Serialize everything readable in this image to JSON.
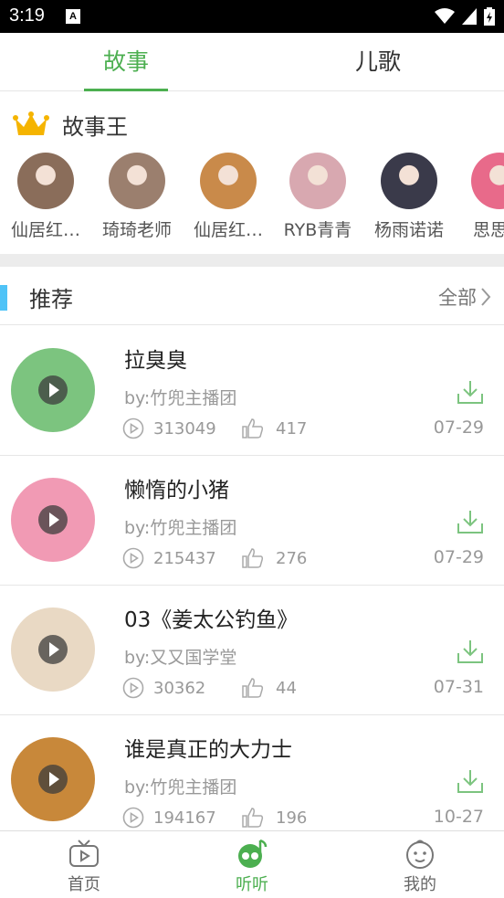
{
  "status_bar": {
    "time": "3:19",
    "notification_letter": "A"
  },
  "tabs": [
    {
      "label": "故事",
      "active": true
    },
    {
      "label": "儿歌",
      "active": false
    }
  ],
  "story_king": {
    "title": "故事王",
    "icon": "crown-icon",
    "avatars": [
      {
        "name": "仙居红…",
        "color": "#8a6d5a"
      },
      {
        "name": "琦琦老师",
        "color": "#9b7f6e"
      },
      {
        "name": "仙居红…",
        "color": "#c98a4a"
      },
      {
        "name": "RYB青青",
        "color": "#d8a8b0"
      },
      {
        "name": "杨雨诺诺",
        "color": "#3a3a4a"
      },
      {
        "name": "思思",
        "color": "#e86a8a"
      }
    ]
  },
  "recommend": {
    "title": "推荐",
    "all_label": "全部"
  },
  "items": [
    {
      "title": "拉臭臭",
      "author": "by:竹兜主播团",
      "plays": "313049",
      "likes": "417",
      "date": "07-29",
      "color": "#7cc47f"
    },
    {
      "title": "懒惰的小猪",
      "author": "by:竹兜主播团",
      "plays": "215437",
      "likes": "276",
      "date": "07-29",
      "color": "#f19ab4"
    },
    {
      "title": "03《姜太公钓鱼》",
      "author": "by:又又国学堂",
      "plays": "30362",
      "likes": "44",
      "date": "07-31",
      "color": "#e9d9c4"
    },
    {
      "title": "谁是真正的大力士",
      "author": "by:竹兜主播团",
      "plays": "194167",
      "likes": "196",
      "date": "10-27",
      "color": "#c8883a"
    }
  ],
  "bottom_nav": [
    {
      "label": "首页",
      "icon": "tv-icon",
      "active": false
    },
    {
      "label": "听听",
      "icon": "music-icon",
      "active": true
    },
    {
      "label": "我的",
      "icon": "baby-face-icon",
      "active": false
    }
  ],
  "colors": {
    "accent": "#4caf50",
    "indicator": "#4fc3f7",
    "text_muted": "#999999"
  }
}
